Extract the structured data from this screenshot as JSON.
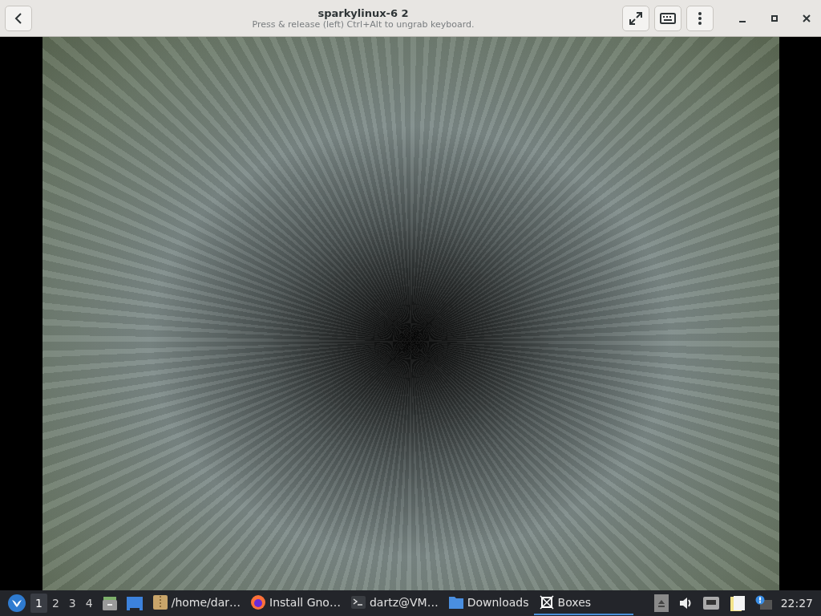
{
  "window": {
    "title": "sparkylinux-6 2",
    "subtitle": "Press & release (left) Ctrl+Alt to ungrab keyboard."
  },
  "taskbar": {
    "workspaces": [
      {
        "label": "1",
        "selected": true
      },
      {
        "label": "2",
        "selected": false
      },
      {
        "label": "3",
        "selected": false
      },
      {
        "label": "4",
        "selected": false
      }
    ],
    "tasks": [
      {
        "kind": "archive",
        "label": "/home/dar…",
        "selected": false
      },
      {
        "kind": "browser",
        "label": "Install Gno…",
        "selected": false
      },
      {
        "kind": "terminal",
        "label": "dartz@VM…",
        "selected": false
      },
      {
        "kind": "folder",
        "label": "Downloads",
        "selected": false
      },
      {
        "kind": "boxes",
        "label": "Boxes",
        "selected": true
      }
    ],
    "clock": "22:27"
  }
}
